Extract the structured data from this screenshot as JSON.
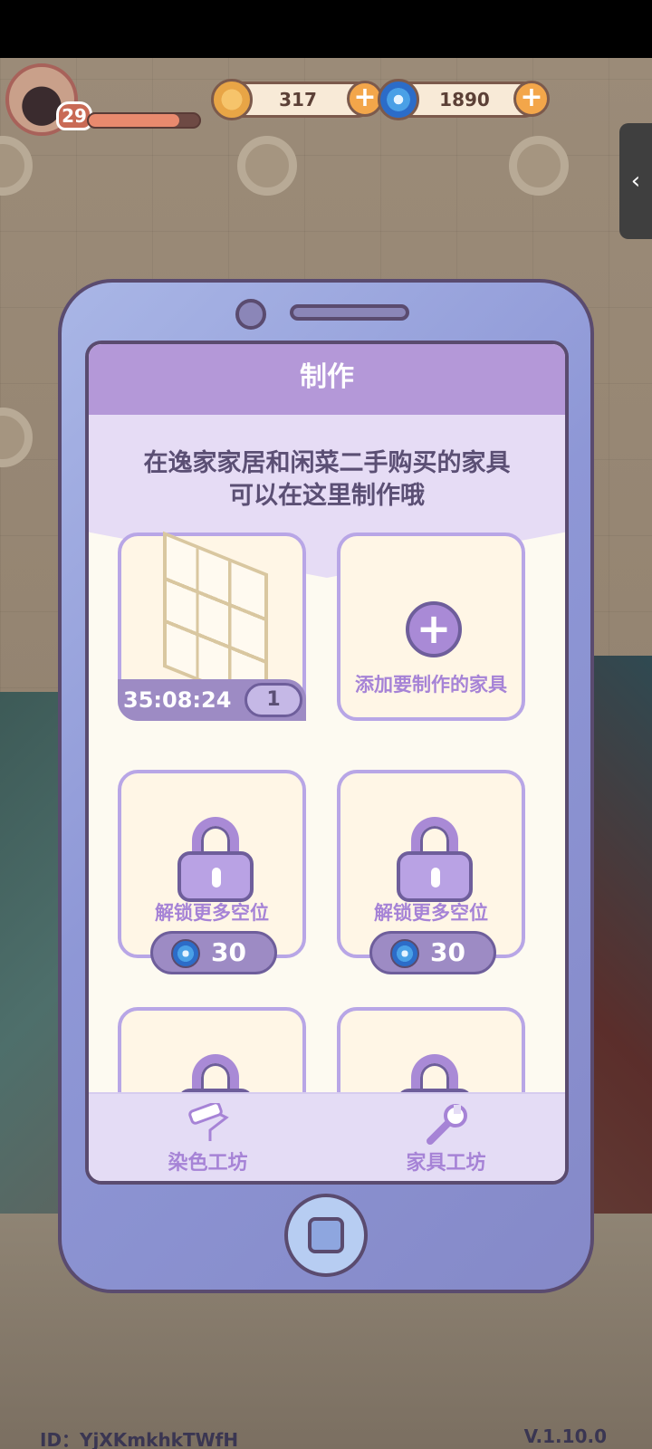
{
  "hud": {
    "level": "29",
    "xp_fraction": 0.82,
    "coins": "317",
    "gems": "1890",
    "side_tab_glyph": "‹"
  },
  "craft": {
    "title": "制作",
    "intro_line1": "在逸家家居和闲菜二手购买的家具",
    "intro_line2": "可以在这里制作哦",
    "active_slot": {
      "timer": "35:08:24",
      "count": "1"
    },
    "add_slot_label": "添加要制作的家具",
    "add_icon_glyph": "+",
    "locked_slots": [
      {
        "label": "解锁更多空位",
        "cost": "30"
      },
      {
        "label": "解锁更多空位",
        "cost": "30"
      }
    ],
    "tabs": [
      {
        "label": "染色工坊",
        "icon": "paint-roller-icon"
      },
      {
        "label": "家具工坊",
        "icon": "wrench-icon"
      }
    ]
  },
  "footer": {
    "id_text": "ID：YjXKmkhkTWfH",
    "version": "V.1.10.0"
  },
  "colors": {
    "header": "#b498d8",
    "accent": "#a683d6",
    "phone": "#8e97d6"
  }
}
